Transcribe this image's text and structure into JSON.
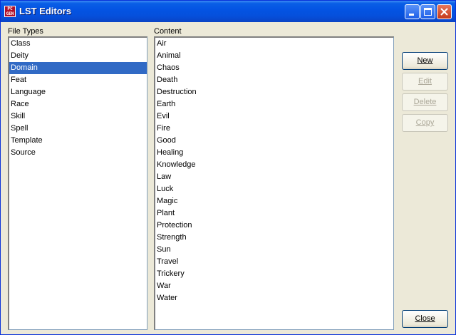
{
  "window": {
    "title": "LST Editors",
    "icon_text": "PC GEN"
  },
  "labels": {
    "file_types": "File Types",
    "content": "Content"
  },
  "file_types": {
    "selected": "Domain",
    "items": [
      "Class",
      "Deity",
      "Domain",
      "Feat",
      "Language",
      "Race",
      "Skill",
      "Spell",
      "Template",
      "Source"
    ]
  },
  "content": {
    "items": [
      "Air",
      "Animal",
      "Chaos",
      "Death",
      "Destruction",
      "Earth",
      "Evil",
      "Fire",
      "Good",
      "Healing",
      "Knowledge",
      "Law",
      "Luck",
      "Magic",
      "Plant",
      "Protection",
      "Strength",
      "Sun",
      "Travel",
      "Trickery",
      "War",
      "Water"
    ]
  },
  "buttons": {
    "new": {
      "label": "New",
      "enabled": true
    },
    "edit": {
      "label": "Edit",
      "enabled": false
    },
    "delete": {
      "label": "Delete",
      "enabled": false
    },
    "copy": {
      "label": "Copy",
      "enabled": false
    },
    "close": {
      "label": "Close",
      "enabled": true
    }
  },
  "icons": {
    "minimize": "minimize-icon",
    "maximize": "maximize-icon",
    "close": "close-icon",
    "app": "pcgen-app-icon"
  },
  "colors": {
    "titlebar": "#0454e3",
    "selection": "#316ac5",
    "window_bg": "#ece9d8",
    "close_button": "#c53a1a"
  }
}
